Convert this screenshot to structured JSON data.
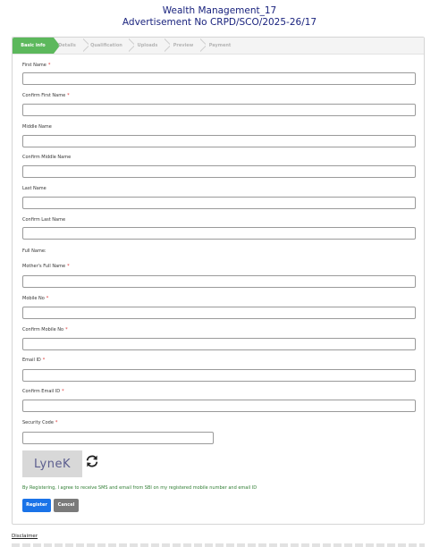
{
  "header": {
    "title": "Wealth Management_17",
    "subtitle": "Advertisement No CRPD/SCO/2025-26/17"
  },
  "steps": [
    {
      "label": "Basic info",
      "active": true
    },
    {
      "label": "Details",
      "active": false
    },
    {
      "label": "Qualification",
      "active": false
    },
    {
      "label": "Uploads",
      "active": false
    },
    {
      "label": "Preview",
      "active": false
    },
    {
      "label": "Payment",
      "active": false
    }
  ],
  "form": {
    "first_name_label": "First Name",
    "confirm_first_name_label": "Confirm First Name",
    "middle_name_label": "Middle Name",
    "confirm_middle_name_label": "Confirm Middle Name",
    "last_name_label": "Last Name",
    "confirm_last_name_label": "Confirm Last Name",
    "full_name_label": "Full Name:",
    "mothers_name_label": "Mother's Full Name",
    "mobile_label": "Mobile No",
    "confirm_mobile_label": "Confirm Mobile No",
    "email_label": "Email ID",
    "confirm_email_label": "Confirm Email ID",
    "security_label": "Security Code",
    "required_mark": "*",
    "captcha_text": "LyneK",
    "consent_text": "By Registering, I agree to receive SMS and email from SBI on my registered mobile number and email ID",
    "register_label": "Register",
    "cancel_label": "Cancel"
  },
  "footer": {
    "disclaimer": "Disclaimer"
  },
  "colors": {
    "accent": "#5cb85c",
    "title": "#1a237e",
    "register": "#1a73e8",
    "cancel": "#7a7a7a",
    "consent": "#2e7d32"
  },
  "icons": {
    "refresh": "refresh-icon"
  }
}
